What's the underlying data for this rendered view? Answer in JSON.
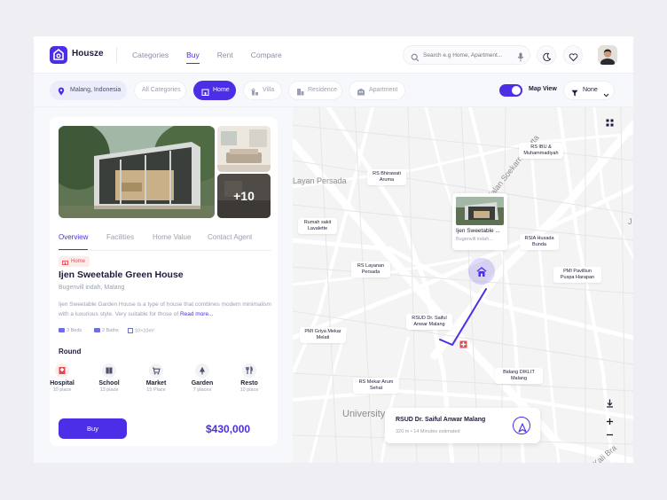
{
  "brand": {
    "name": "Housze",
    "color": "#4B2EE6"
  },
  "nav": [
    {
      "label": "Categories",
      "active": false
    },
    {
      "label": "Buy",
      "active": true
    },
    {
      "label": "Rent",
      "active": false
    },
    {
      "label": "Compare",
      "active": false
    }
  ],
  "search": {
    "placeholder": "Search e.g Home, Apartment...",
    "icon": "search-icon",
    "mic_icon": "microphone-icon"
  },
  "header_actions": [
    "moon-icon",
    "heart-icon"
  ],
  "filters": {
    "location": "Malang, Indonesia",
    "categories": [
      {
        "label": "All Categories",
        "selected": false
      },
      {
        "label": "Home",
        "selected": true
      },
      {
        "label": "Villa",
        "selected": false
      },
      {
        "label": "Residence",
        "selected": false
      },
      {
        "label": "Apartment",
        "selected": false
      }
    ],
    "map_view_label": "Map View",
    "map_view_on": true,
    "sort_label": "None"
  },
  "listing": {
    "more_photos": "+10",
    "tabs": [
      "Overview",
      "Facilities",
      "Home Value",
      "Contact Agent"
    ],
    "badge": "Home",
    "title": "Ijen Sweetable Green House",
    "location": "Bugenvill indah, Malang",
    "description": "Ijen Sweetable Garden House is a type of house that combines modern minimalism with a luxurious style. Very suitable for those of",
    "read_more": "Read more...",
    "specs": [
      "3 Beds",
      "2 Baths",
      "10×10m²"
    ],
    "round_title": "Round",
    "amenities": [
      {
        "name": "Hospital",
        "count": "10 place",
        "icon": "hospital-icon"
      },
      {
        "name": "School",
        "count": "13 place",
        "icon": "book-icon"
      },
      {
        "name": "Market",
        "count": "15 Place",
        "icon": "cart-icon"
      },
      {
        "name": "Garden",
        "count": "7 places",
        "icon": "tree-icon"
      },
      {
        "name": "Resto",
        "count": "10 place",
        "icon": "cutlery-icon"
      }
    ],
    "buy_label": "Buy",
    "price": "$430,000"
  },
  "map": {
    "labels": [
      "RS IBU & Muhammadiyah",
      "RS Bhirawati Aruma",
      "Rumah sakit Lavalette",
      "RSIA Husada Bunda",
      "RS Layanan Persada",
      "PMI Pavilliun Puspa Harapan",
      "RSUD Dr. Saiful Anwar Malang",
      "PMI Griya Mekar Melati",
      "Bidang DIKLIT Malang",
      "RS Mekar Arum Sehat"
    ],
    "streets": [
      "Layan Persada",
      "Jalan Soekarno-Hatta",
      "University",
      "Kali Bra",
      "J"
    ],
    "pin_card": {
      "title": "Ijen Sweetable ...",
      "subtitle": "Bugenvill indah..."
    },
    "route_card": {
      "title": "RSUD Dr. Saiful Anwar Malang",
      "meta": "320 m • 14 Minutes estimated"
    },
    "route_color": "#4B2EE6"
  }
}
